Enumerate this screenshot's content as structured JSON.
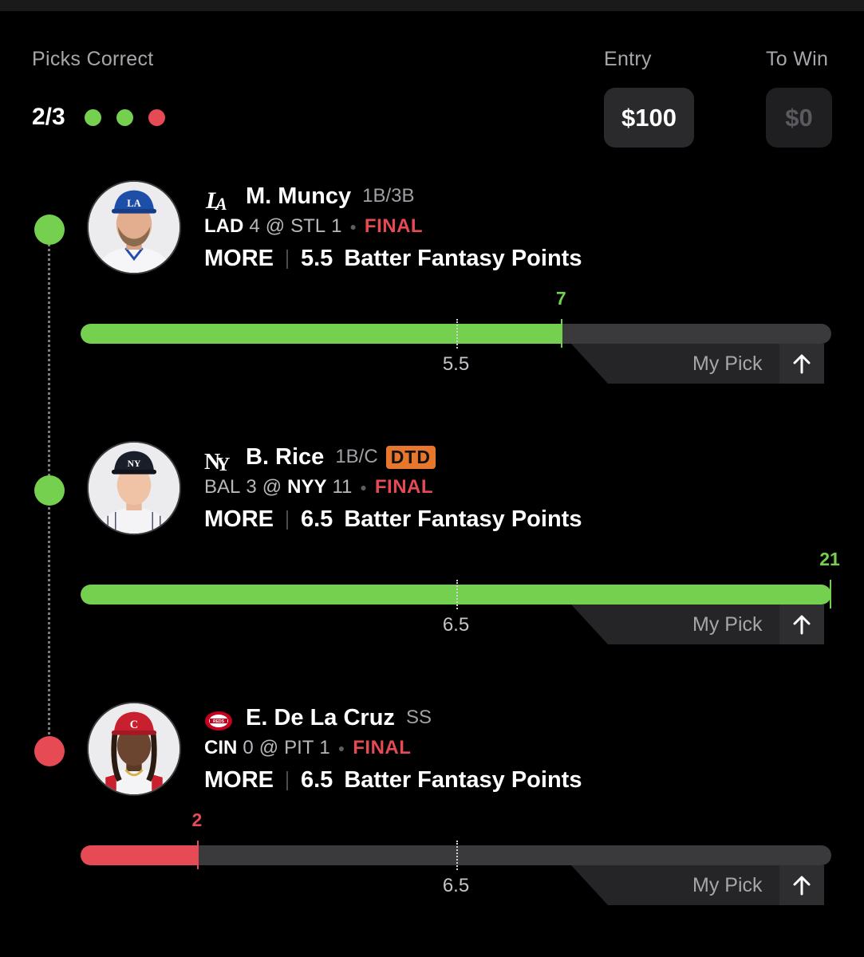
{
  "header": {
    "picks_correct_label": "Picks Correct",
    "entry_label": "Entry",
    "to_win_label": "To Win",
    "score": "2/3",
    "entry_value": "$100",
    "to_win_value": "$0",
    "result_dots": [
      "correct",
      "correct",
      "incorrect"
    ]
  },
  "colors": {
    "correct": "#75d04f",
    "incorrect": "#e64a55",
    "dtd_badge": "#e8772e",
    "background": "#000000"
  },
  "picks": [
    {
      "team_logo_icon": "dodgers-la-logo-icon",
      "player_name": "M. Muncy",
      "position": "1B/3B",
      "badge": "",
      "away_team": "LAD",
      "away_score": "4",
      "at": "@",
      "home_team": "STL",
      "home_score": "1",
      "away_bold": true,
      "home_bold": false,
      "status": "FINAL",
      "direction": "MORE",
      "line": "5.5",
      "stat": "Batter Fantasy Points",
      "result_value": "7",
      "result_fraction": 0.64,
      "line_fraction": 0.5,
      "line_label": "5.5",
      "outcome": "correct",
      "my_pick_label": "My Pick"
    },
    {
      "team_logo_icon": "yankees-ny-logo-icon",
      "player_name": "B. Rice",
      "position": "1B/C",
      "badge": "DTD",
      "away_team": "BAL",
      "away_score": "3",
      "at": "@",
      "home_team": "NYY",
      "home_score": "11",
      "away_bold": false,
      "home_bold": true,
      "status": "FINAL",
      "direction": "MORE",
      "line": "6.5",
      "stat": "Batter Fantasy Points",
      "result_value": "21",
      "result_fraction": 1.0,
      "line_fraction": 0.5,
      "line_label": "6.5",
      "outcome": "correct",
      "my_pick_label": "My Pick"
    },
    {
      "team_logo_icon": "reds-logo-icon",
      "player_name": "E. De La Cruz",
      "position": "SS",
      "badge": "",
      "away_team": "CIN",
      "away_score": "0",
      "at": "@",
      "home_team": "PIT",
      "home_score": "1",
      "away_bold": true,
      "home_bold": false,
      "status": "FINAL",
      "direction": "MORE",
      "line": "6.5",
      "stat": "Batter Fantasy Points",
      "result_value": "2",
      "result_fraction": 0.155,
      "line_fraction": 0.5,
      "line_label": "6.5",
      "outcome": "incorrect",
      "my_pick_label": "My Pick"
    }
  ]
}
